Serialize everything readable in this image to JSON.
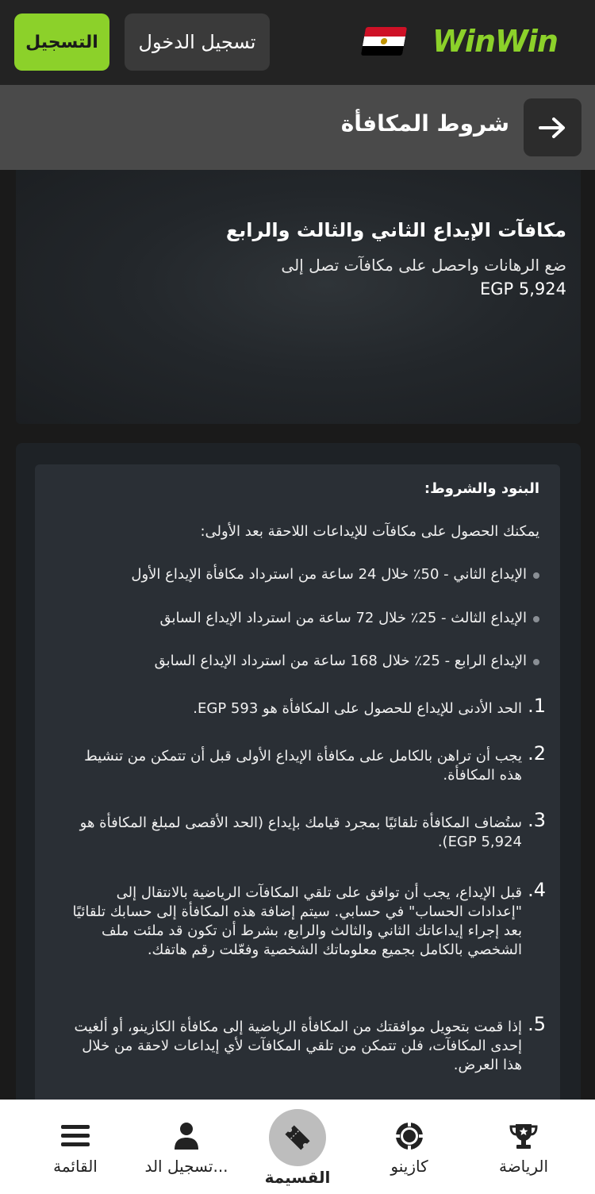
{
  "header": {
    "logo": "WinWin",
    "login_label": "تسجيل الدخول",
    "register_label": "التسجيل"
  },
  "titlebar": {
    "title": "شروط المكافأة"
  },
  "banner": {
    "heading": "مكافآت الإيداع الثاني والثالث والرابع",
    "subtitle": "ضع الرهانات واحصل على مكافآت تصل إلى",
    "amount": "EGP 5,924"
  },
  "terms": {
    "heading": "البنود والشروط:",
    "intro": "يمكنك الحصول على مكافآت للإيداعات اللاحقة بعد الأولى:",
    "bullets": [
      "الإيداع الثاني - 50٪ خلال 24 ساعة من استرداد مكافأة الإيداع الأول",
      "الإيداع الثالث - 25٪ خلال 72 ساعة من استرداد الإيداع السابق",
      "الإيداع الرابع - 25٪ خلال 168 ساعة من استرداد الإيداع السابق"
    ],
    "items": [
      {
        "n": "1.",
        "text": "الحد الأدنى للإيداع للحصول على المكافأة هو EGP 593."
      },
      {
        "n": "2.",
        "text": "يجب أن تراهن بالكامل على مكافأة الإيداع الأولى قبل أن تتمكن من تنشيط هذه المكافأة."
      },
      {
        "n": "3.",
        "text": "ستُضاف المكافأة تلقائيًا بمجرد قيامك بإيداع (الحد الأقصى لمبلغ المكافأة هو  EGP 5,924)."
      },
      {
        "n": "4.",
        "text": "قبل الإيداع، يجب أن توافق على تلقي المكافآت الرياضية بالانتقال إلى \"إعدادات الحساب\" في حسابي. سيتم إضافة هذه المكافأة إلى حسابك تلقائيًا بعد إجراء إيداعاتك الثاني والثالث والرابع، بشرط أن تكون قد ملئت ملف الشخصي بالكامل بجميع معلوماتك الشخصية وفعّلت رقم هاتفك."
      },
      {
        "n": "5.",
        "text": "إذا قمت بتحويل موافقتك من المكافأة الرياضية إلى مكافأة الكازينو، أو ألغيت إحدى المكافآت، فلن تتمكن من تلقي المكافآت لأي إيداعات لاحقة من خلال هذا العرض."
      }
    ]
  },
  "bottom_nav": {
    "sports": "الرياضة",
    "casino": "كازينو",
    "coupon": "القسيمة",
    "register": "تسجيل الد...",
    "menu": "القائمة"
  },
  "colors": {
    "accent": "#8cd12a",
    "header_bg": "#232323",
    "titlebar_bg": "#4a4a4a"
  }
}
